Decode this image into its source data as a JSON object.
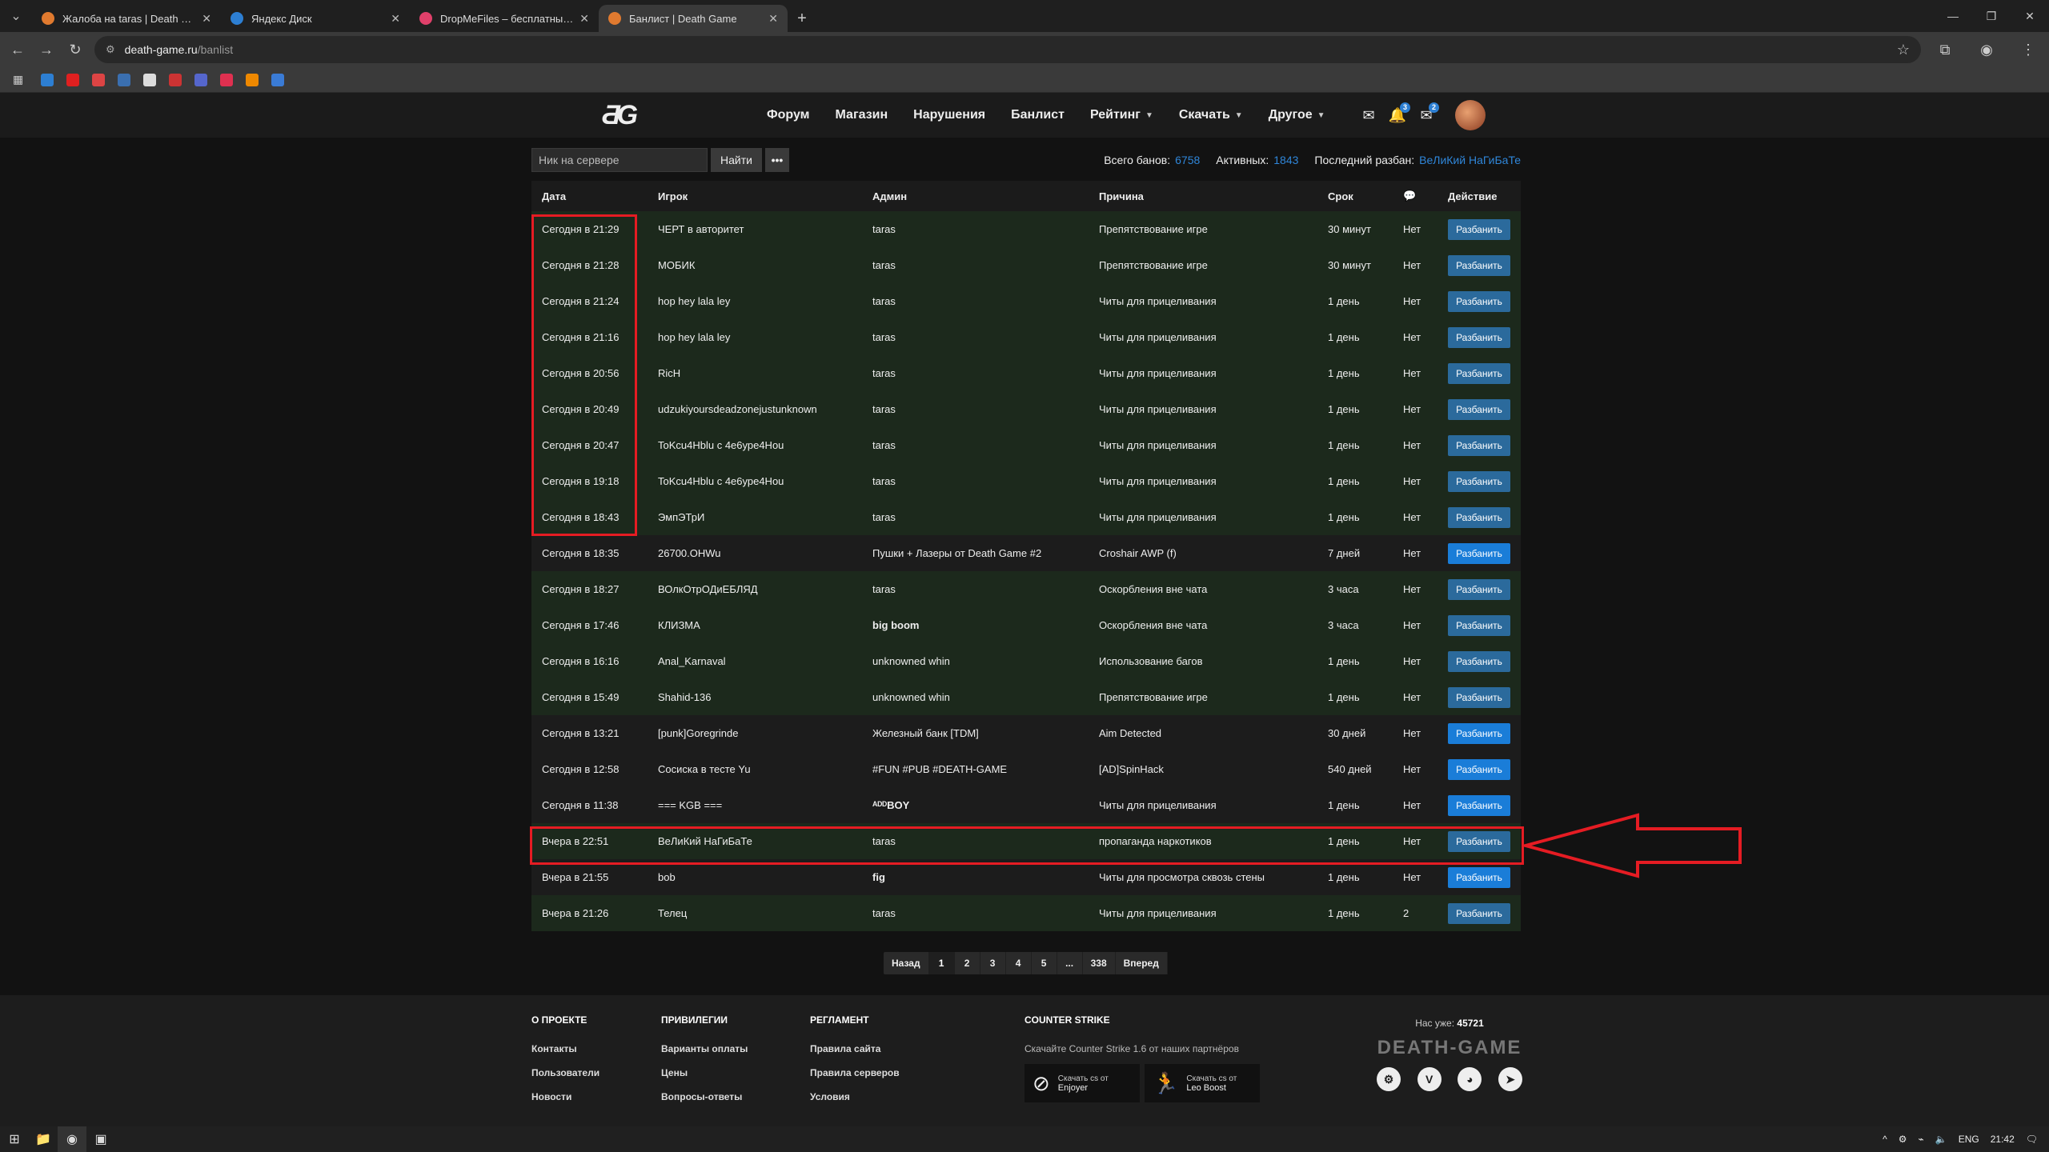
{
  "browser": {
    "tabs": [
      {
        "label": "Жалоба на taras | Death Game",
        "color": "#e07a2f",
        "active": false
      },
      {
        "label": "Яндекс Диск",
        "color": "#2d7fd3",
        "active": false
      },
      {
        "label": "DropMeFiles – бесплатный фа",
        "color": "#e0406a",
        "active": false
      },
      {
        "label": "Банлист | Death Game",
        "color": "#e07a2f",
        "active": true
      }
    ],
    "url_host": "death-game.ru",
    "url_path": "/banlist"
  },
  "header": {
    "logo": "ƋG",
    "nav": [
      {
        "label": "Форум",
        "dropdown": false
      },
      {
        "label": "Магазин",
        "dropdown": false
      },
      {
        "label": "Нарушения",
        "dropdown": false
      },
      {
        "label": "Банлист",
        "dropdown": false
      },
      {
        "label": "Рейтинг",
        "dropdown": true
      },
      {
        "label": "Скачать",
        "dropdown": true
      },
      {
        "label": "Другое",
        "dropdown": true
      }
    ],
    "notif_count": "3",
    "msg_count": "2"
  },
  "search": {
    "placeholder": "Ник на сервере",
    "find_label": "Найти",
    "more_label": "•••"
  },
  "stats": {
    "total_label": "Всего банов:",
    "total": "6758",
    "active_label": "Активных:",
    "active": "1843",
    "last_unban_label": "Последний разбан:",
    "last_unban": "ВеЛиКий НаГиБаТе"
  },
  "table": {
    "headers": [
      "Дата",
      "Игрок",
      "Админ",
      "Причина",
      "Срок",
      "💬",
      "Действие"
    ],
    "unban_label": "Разбанить",
    "rows": [
      {
        "date": "Сегодня в 21:29",
        "player": "ЧЕРТ в авторитет",
        "admin": "taras",
        "reason": "Препятствование игре",
        "term": "30 минут",
        "comments": "Нет",
        "active": true
      },
      {
        "date": "Сегодня в 21:28",
        "player": "МОБИК",
        "admin": "taras",
        "reason": "Препятствование игре",
        "term": "30 минут",
        "comments": "Нет",
        "active": true
      },
      {
        "date": "Сегодня в 21:24",
        "player": "hop hey lala ley",
        "admin": "taras",
        "reason": "Читы для прицеливания",
        "term": "1 день",
        "comments": "Нет",
        "active": true
      },
      {
        "date": "Сегодня в 21:16",
        "player": "hop hey lala ley",
        "admin": "taras",
        "reason": "Читы для прицеливания",
        "term": "1 день",
        "comments": "Нет",
        "active": true
      },
      {
        "date": "Сегодня в 20:56",
        "player": "RicH",
        "admin": "taras",
        "reason": "Читы для прицеливания",
        "term": "1 день",
        "comments": "Нет",
        "active": true
      },
      {
        "date": "Сегодня в 20:49",
        "player": "udzukiyoursdeadzonejustunknown",
        "admin": "taras",
        "reason": "Читы для прицеливания",
        "term": "1 день",
        "comments": "Нет",
        "active": true
      },
      {
        "date": "Сегодня в 20:47",
        "player": "ToKcu4Hblu с 4е6уре4Hou",
        "admin": "taras",
        "reason": "Читы для прицеливания",
        "term": "1 день",
        "comments": "Нет",
        "active": true
      },
      {
        "date": "Сегодня в 19:18",
        "player": "ToKcu4Hblu с 4е6уре4Hou",
        "admin": "taras",
        "reason": "Читы для прицеливания",
        "term": "1 день",
        "comments": "Нет",
        "active": true
      },
      {
        "date": "Сегодня в 18:43",
        "player": "ЭмпЭТрИ",
        "admin": "taras",
        "reason": "Читы для прицеливания",
        "term": "1 день",
        "comments": "Нет",
        "active": true
      },
      {
        "date": "Сегодня в 18:35",
        "player": "26700.OHWu",
        "admin": "Пушки + Лазеры от Death Game #2",
        "reason": "Croshair AWP (f)",
        "term": "7 дней",
        "comments": "Нет",
        "active": false
      },
      {
        "date": "Сегодня в 18:27",
        "player": "ВОлкОтрОДиЕБЛЯД",
        "admin": "taras",
        "reason": "Оскорбления вне чата",
        "term": "3 часа",
        "comments": "Нет",
        "active": true
      },
      {
        "date": "Сегодня в 17:46",
        "player": "КЛИЗМА",
        "admin": "big boom",
        "reason": "Оскорбления вне чата",
        "term": "3 часа",
        "comments": "Нет",
        "active": true,
        "admin_bold": true
      },
      {
        "date": "Сегодня в 16:16",
        "player": "Anal_Karnaval",
        "admin": "unknowned whin",
        "reason": "Использование багов",
        "term": "1 день",
        "comments": "Нет",
        "active": true
      },
      {
        "date": "Сегодня в 15:49",
        "player": "Shahid-136",
        "admin": "unknowned whin",
        "reason": "Препятствование игре",
        "term": "1 день",
        "comments": "Нет",
        "active": true
      },
      {
        "date": "Сегодня в 13:21",
        "player": "[punk]Goregrinde",
        "admin": "Железный банк [TDM]",
        "reason": "Aim Detected",
        "term": "30 дней",
        "comments": "Нет",
        "active": false
      },
      {
        "date": "Сегодня в 12:58",
        "player": "Сосиска в тесте Yu",
        "admin": "#FUN #PUB #DEATH-GAME",
        "reason": "[AD]SpinHack",
        "term": "540 дней",
        "comments": "Нет",
        "active": false
      },
      {
        "date": "Сегодня в 11:38",
        "player": "=== KGB ===",
        "admin": "ᴬᴰᴰBOY",
        "reason": "Читы для прицеливания",
        "term": "1 день",
        "comments": "Нет",
        "active": false,
        "admin_bold": true
      },
      {
        "date": "Вчера в 22:51",
        "player": "ВеЛиКий НаГиБаТе",
        "admin": "taras",
        "reason": "пропаганда наркотиков",
        "term": "1 день",
        "comments": "Нет",
        "active": true
      },
      {
        "date": "Вчера в 21:55",
        "player": "bob",
        "admin": "fig",
        "reason": "Читы для просмотра сквозь стены",
        "term": "1 день",
        "comments": "Нет",
        "active": false,
        "admin_bold": true
      },
      {
        "date": "Вчера в 21:26",
        "player": "Телец",
        "admin": "taras",
        "reason": "Читы для прицеливания",
        "term": "1 день",
        "comments": "2",
        "active": true
      }
    ]
  },
  "pagination": [
    "Назад",
    "1",
    "2",
    "3",
    "4",
    "5",
    "...",
    "338",
    "Вперед"
  ],
  "footer": {
    "col1": {
      "title": "О ПРОЕКТЕ",
      "links": [
        "Контакты",
        "Пользователи",
        "Новости"
      ]
    },
    "col2": {
      "title": "ПРИВИЛЕГИИ",
      "links": [
        "Варианты оплаты",
        "Цены",
        "Вопросы-ответы"
      ]
    },
    "col3": {
      "title": "РЕГЛАМЕНТ",
      "links": [
        "Правила сайта",
        "Правила серверов",
        "Условия"
      ]
    },
    "col4": {
      "title": "COUNTER STRIKE",
      "desc": "Скачайте Counter Strike 1.6 от наших партнёров",
      "btn1_small": "Скачать cs от",
      "btn1": "Enjoyer",
      "btn2_small": "Скачать cs от",
      "btn2": "Leo Boost"
    },
    "online_label": "Нас уже:",
    "online_count": "45721",
    "logo": "DEATH-GAME"
  },
  "taskbar": {
    "lang": "ENG",
    "time": "21:42"
  }
}
